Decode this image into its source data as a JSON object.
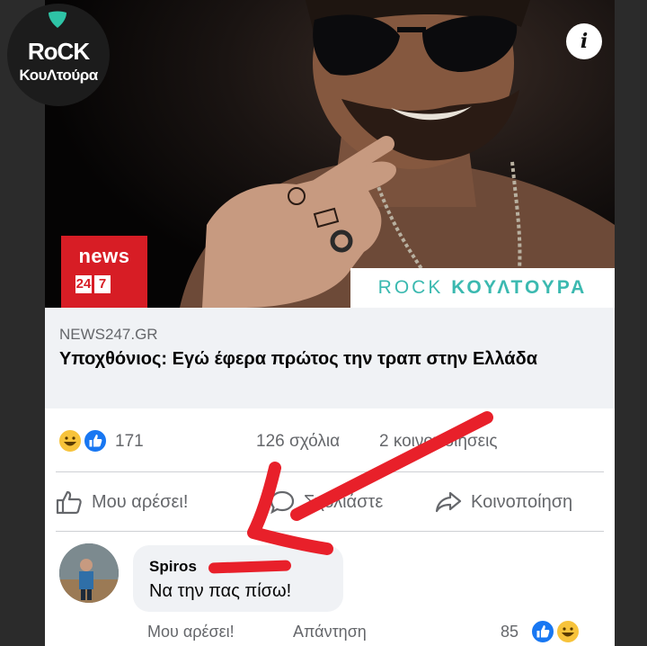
{
  "site_logo": {
    "line1": "RoCK",
    "line2": "ΚουΛτούρα",
    "accent": "#2ec4a6"
  },
  "hero": {
    "badge_word": "news",
    "badge_digits": [
      "24",
      "7"
    ],
    "strip_light": "ROCK",
    "strip_bold": "ΚΟΥΛΤΟΥΡΑ",
    "info_icon": "info-icon",
    "badge_color": "#d71d25",
    "strip_color": "#3bb9b0"
  },
  "link": {
    "domain": "NEWS247.GR",
    "title": "Υποχθόνιος: Εγώ έφερα πρώτος την τραπ στην Ελλάδα"
  },
  "reactions": {
    "icons": [
      "haha-icon",
      "like-icon"
    ],
    "count": "171",
    "comments": "126 σχόλια",
    "shares": "2 κοινοποιήσεις"
  },
  "actions": {
    "like": "Μου αρέσει!",
    "comment": "Σχολιάστε",
    "share": "Κοινοποίηση"
  },
  "comment": {
    "author": "Spiros",
    "text": "Να την πας πίσω!",
    "like": "Μου αρέσει!",
    "reply": "Απάντηση",
    "reaction_count": "85"
  },
  "colors": {
    "facebook_blue": "#1877f2",
    "annotation_red": "#e8202a",
    "muted_text": "#65676b"
  }
}
